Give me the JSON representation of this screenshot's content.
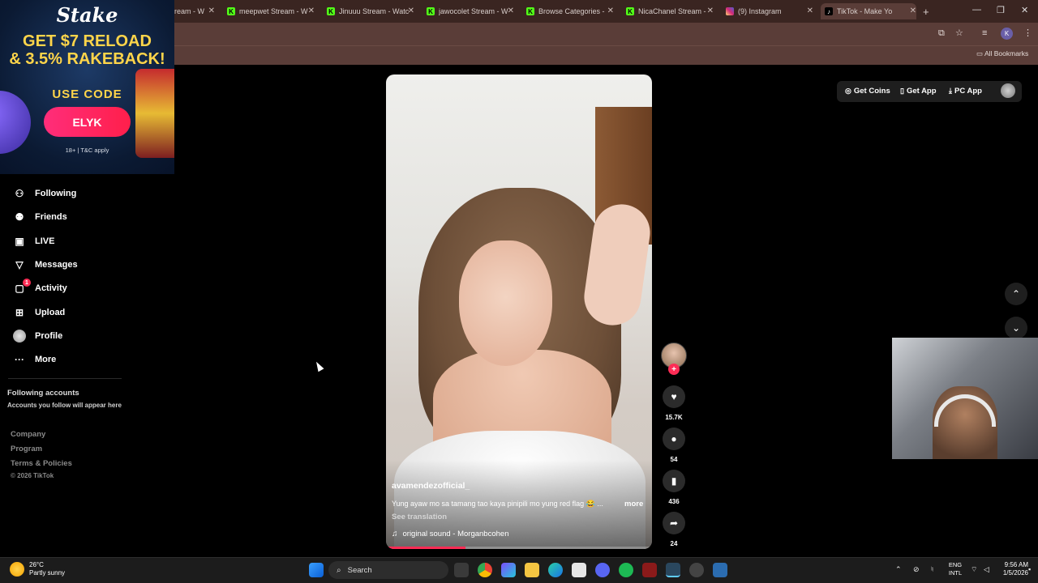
{
  "browser": {
    "tabs": [
      {
        "title": "ream - W",
        "icon": "kick-icon",
        "active": false
      },
      {
        "title": "meepwet Stream - W",
        "icon": "kick-icon",
        "active": false
      },
      {
        "title": "Jinuuu Stream - Watc",
        "icon": "kick-icon",
        "active": false
      },
      {
        "title": "jawocolet Stream - W",
        "icon": "kick-icon",
        "active": false
      },
      {
        "title": "Browse Categories -",
        "icon": "kick-icon",
        "active": false
      },
      {
        "title": "NicaChanel Stream -",
        "icon": "kick-icon",
        "active": false
      },
      {
        "title": "(9) Instagram",
        "icon": "instagram-icon",
        "active": false
      },
      {
        "title": "TikTok - Make Yo",
        "icon": "tiktok-icon",
        "active": true
      }
    ],
    "new_tab": "+",
    "profile_initial": "K",
    "bookmarks_label": "All Bookmarks",
    "window_controls": {
      "minimize": "—",
      "restore": "❐",
      "close": "✕"
    }
  },
  "ad": {
    "brand": "Stake",
    "headline_1": "GET $7 RELOAD",
    "headline_2": "& 3.5% RAKEBACK!",
    "use_code": "USE CODE",
    "code": "ELYK",
    "terms": "18+ | T&C apply"
  },
  "sidebar": {
    "items": [
      {
        "label": "Following",
        "icon": "following-icon"
      },
      {
        "label": "Friends",
        "icon": "friends-icon"
      },
      {
        "label": "LIVE",
        "icon": "live-icon"
      },
      {
        "label": "Messages",
        "icon": "messages-icon"
      },
      {
        "label": "Activity",
        "icon": "activity-icon",
        "badge": "1"
      },
      {
        "label": "Upload",
        "icon": "upload-icon"
      },
      {
        "label": "Profile",
        "icon": "profile-avatar"
      },
      {
        "label": "More",
        "icon": "more-icon"
      }
    ],
    "following_accounts_title": "Following accounts",
    "following_accounts_sub": "Accounts you follow will appear here",
    "footer_links": [
      "Company",
      "Program",
      "Terms & Policies"
    ],
    "copyright": "© 2026 TikTok"
  },
  "video": {
    "username": "avamendezofficial_",
    "caption": "Yung ayaw mo sa tamang tao kaya pinipili mo yung red flag 😂 ...",
    "more": "more",
    "see_translation": "See translation",
    "sound": "original sound - Morganbcohen",
    "progress": 0.3
  },
  "actions": {
    "likes": "15.7K",
    "comments": "54",
    "saves": "436",
    "shares": "24"
  },
  "top_actions": {
    "get_coins": "Get Coins",
    "get_app": "Get App",
    "pc_app": "PC App"
  },
  "taskbar": {
    "temperature": "26°C",
    "weather": "Partly sunny",
    "search_placeholder": "Search",
    "lang_1": "ENG",
    "lang_2": "INTL",
    "time": "9:56 AM",
    "date": "1/5/2026"
  },
  "colors": {
    "accent": "#fe2c55",
    "browser_frame": "#3a2521",
    "background": "#000000"
  }
}
